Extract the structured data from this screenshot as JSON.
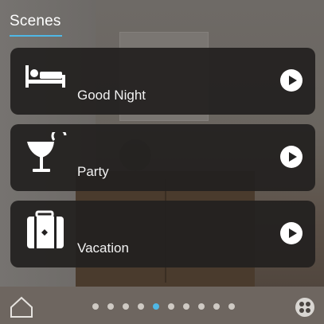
{
  "header": {
    "title": "Scenes"
  },
  "scenes": [
    {
      "label": "Good Night",
      "icon": "bed-icon"
    },
    {
      "label": "Party",
      "icon": "cocktail-icon"
    },
    {
      "label": "Vacation",
      "icon": "suitcase-icon"
    }
  ],
  "pager": {
    "count": 10,
    "active_index": 4
  },
  "colors": {
    "accent": "#4fb8e6",
    "card": "#222020",
    "text": "#ffffff"
  }
}
